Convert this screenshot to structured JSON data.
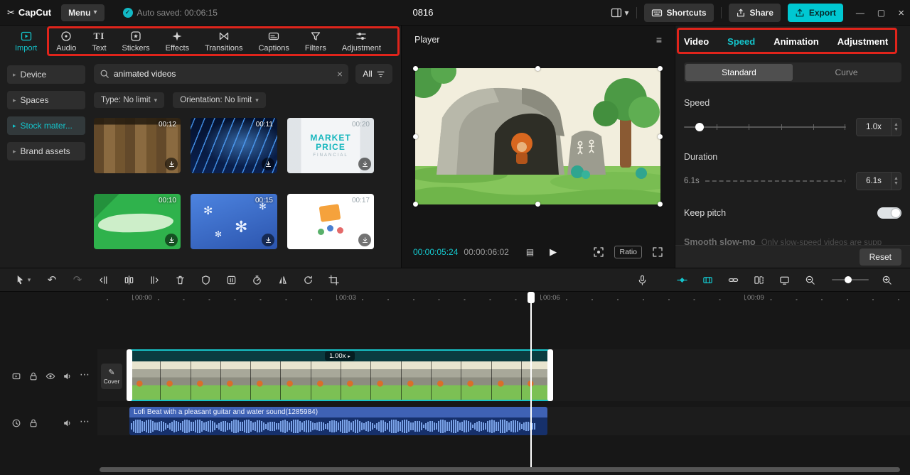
{
  "colors": {
    "accent": "#14c4cb",
    "annotation": "#e0241b",
    "export_button": "#00c8d2",
    "audio_clip": "#16306b",
    "clip_selection": "#17c3c9"
  },
  "icons": {
    "chevron_down": "▾",
    "triangle_right": "▸",
    "ellipsis": "⋯",
    "play": "▶",
    "close": "×",
    "minimize": "—",
    "maximize": "▢",
    "hamburger": "≡",
    "check": "✓",
    "frames": "▤",
    "badge_arrow": "▸",
    "stepper_up": "▲",
    "stepper_down": "▼",
    "arrow_right": "›",
    "snowflake": "✻",
    "undo": "↶",
    "redo": "↷",
    "pencil": "✎",
    "clear": "×"
  },
  "titlebar": {
    "app_name": "CapCut",
    "logo_mark": "✂",
    "menu_label": "Menu",
    "autosave_text": "Auto saved: 00:06:15",
    "doc_title": "0816",
    "shortcuts_label": "Shortcuts",
    "share_label": "Share",
    "export_label": "Export"
  },
  "media_toolbar": {
    "tabs": [
      {
        "label": "Import"
      },
      {
        "label": "Audio"
      },
      {
        "label": "Text"
      },
      {
        "label": "Stickers"
      },
      {
        "label": "Effects"
      },
      {
        "label": "Transitions"
      },
      {
        "label": "Captions"
      },
      {
        "label": "Filters"
      },
      {
        "label": "Adjustment"
      }
    ],
    "text_icon_glyph": "TI"
  },
  "sidebar": {
    "items": [
      {
        "label": "Device"
      },
      {
        "label": "Spaces"
      },
      {
        "label": "Stock mater..."
      },
      {
        "label": "Brand assets"
      }
    ]
  },
  "library": {
    "search_value": "animated videos",
    "all_label": "All",
    "filters": [
      {
        "label": "Type: No limit"
      },
      {
        "label": "Orientation: No limit"
      }
    ],
    "items": [
      {
        "duration": "00:12"
      },
      {
        "duration": "00:11"
      },
      {
        "duration": "00:20",
        "text_line1": "MARKET",
        "text_line2": "PRICE",
        "text_line3": "FINANCIAL"
      },
      {
        "duration": "00:10"
      },
      {
        "duration": "00:15"
      },
      {
        "duration": "00:17"
      }
    ]
  },
  "player": {
    "title": "Player",
    "current_time": "00:00:05:24",
    "total_time": "00:00:06:02",
    "ratio_label": "Ratio"
  },
  "inspector": {
    "tabs": [
      {
        "label": "Video"
      },
      {
        "label": "Speed"
      },
      {
        "label": "Animation"
      },
      {
        "label": "Adjustment"
      }
    ],
    "mode_tabs": [
      {
        "label": "Standard"
      },
      {
        "label": "Curve"
      }
    ],
    "speed_label": "Speed",
    "speed_value": "1.0x",
    "duration_label": "Duration",
    "duration_left": "6.1s",
    "duration_value": "6.1s",
    "keep_pitch_label": "Keep pitch",
    "smooth_label": "Smooth slow-mo",
    "smooth_hint": "Only slow-speed videos are supp",
    "reset_label": "Reset"
  },
  "timeline": {
    "ruler_labels": [
      "00:00",
      "00:03",
      "00:06",
      "00:09"
    ],
    "cover_label": "Cover",
    "clip_speed_badge": "1.00x",
    "audio_label": "Lofi Beat with a pleasant guitar and water sound(1285984)"
  }
}
